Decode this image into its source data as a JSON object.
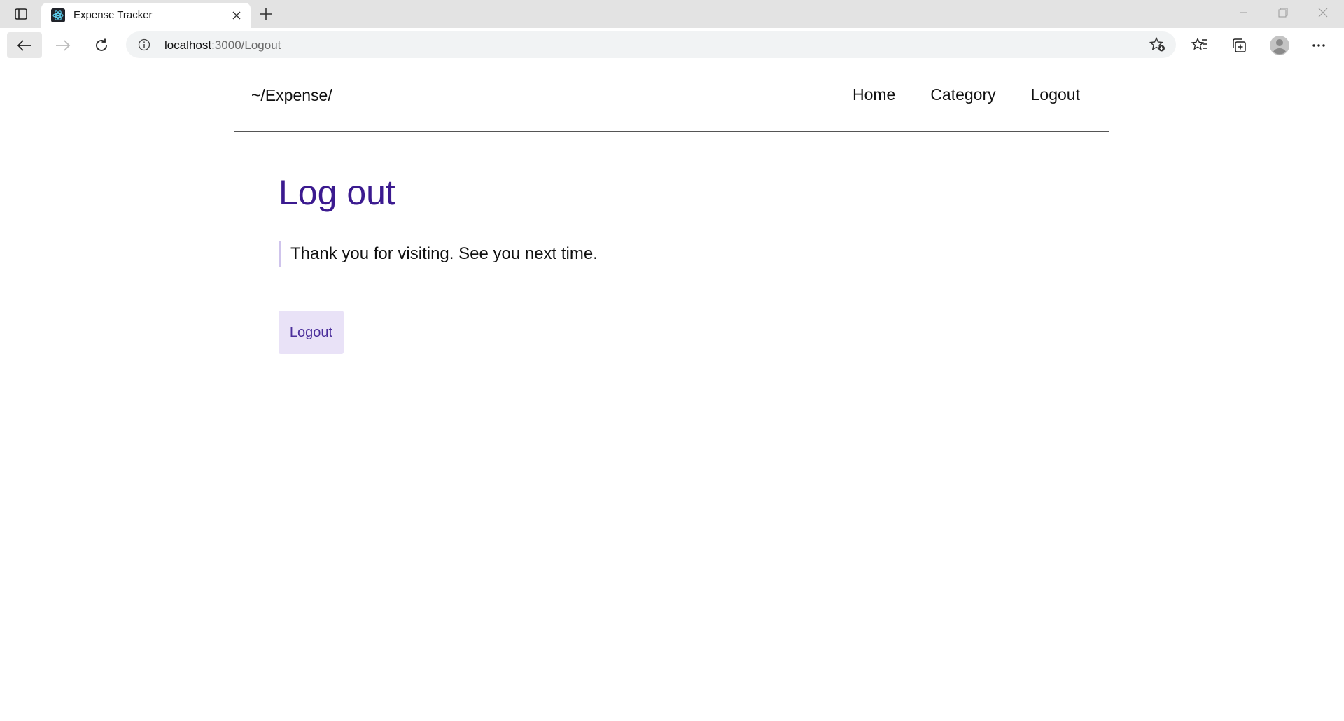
{
  "browser": {
    "tab_title": "Expense Tracker",
    "url_host": "localhost",
    "url_rest": ":3000/Logout",
    "icons": {
      "tab_actions": "tab-actions-icon",
      "favicon": "react-atom-icon",
      "tab_close": "close-icon",
      "new_tab": "plus-icon",
      "back": "arrow-left-icon",
      "forward": "arrow-right-icon",
      "refresh": "refresh-icon",
      "site_info": "info-icon",
      "add_favorite": "star-plus-icon",
      "favorites": "favorites-list-icon",
      "collections": "collections-icon",
      "profile": "avatar-icon",
      "more": "more-icon"
    }
  },
  "site": {
    "brand": "~/Expense/",
    "nav": {
      "home": "Home",
      "category": "Category",
      "logout": "Logout"
    }
  },
  "main": {
    "title": "Log out",
    "message": "Thank you for visiting. See you next time.",
    "button_label": "Logout"
  },
  "colors": {
    "title": "#3b1a8f",
    "button_bg": "#e9e2f7",
    "button_text": "#4b2e9b",
    "quote_border": "#cfc4ec"
  }
}
